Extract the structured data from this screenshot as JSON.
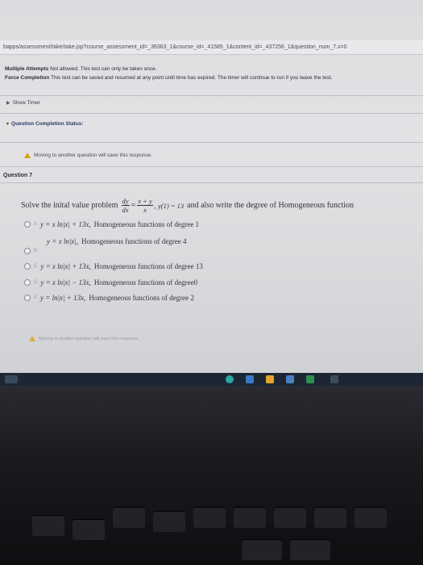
{
  "url": "bapps/assessment/take/take.jsp?course_assessment_id=_36363_1&course_id=_41585_1&content_id=_437256_1&question_num_7.x=0",
  "info": {
    "multiple_attempts_label": "Multiple Attempts",
    "multiple_attempts_text": "Not allowed. This test can only be taken once.",
    "force_completion_label": "Force Completion",
    "force_completion_text": "This test can be saved and resumed at any point until time has expired. The timer will continue to run if you leave the test."
  },
  "show_timer": "Show Timer",
  "question_completion_status": "Question Completion Status:",
  "warning_text": "Moving to another question will save this response.",
  "question_label": "Question 7",
  "prompt": {
    "prefix": "Solve the inital value problem",
    "frac1_num": "dy",
    "frac1_den": "dx",
    "equals": "=",
    "frac2_num": "x + y",
    "frac2_den": "x",
    "condition": ", y(1) = 13",
    "suffix": "and also write the degree of Homogeneous function"
  },
  "options": [
    {
      "letter": "A",
      "math": "y = x ln|x| + 13x,",
      "text": "Homogeneous functions of degree 1"
    },
    {
      "letter": "B",
      "math": "y = x ln|x|,",
      "text": "Homogeneous functions of degree 4"
    },
    {
      "letter": "C",
      "math": "y = x ln|x| + 13x,",
      "text": "Homogeneous functions of degree 13"
    },
    {
      "letter": "D",
      "math": "y = x ln|x| − 13x,",
      "text": "Homogeneous functions of degree0"
    },
    {
      "letter": "E",
      "math": "y = ln|x| + 13x,",
      "text": "Homogeneous functions of degree 2"
    }
  ],
  "colors": {
    "warning": "#d9a21a",
    "status_text": "#2d3a66",
    "taskbar": "#1c2733"
  }
}
